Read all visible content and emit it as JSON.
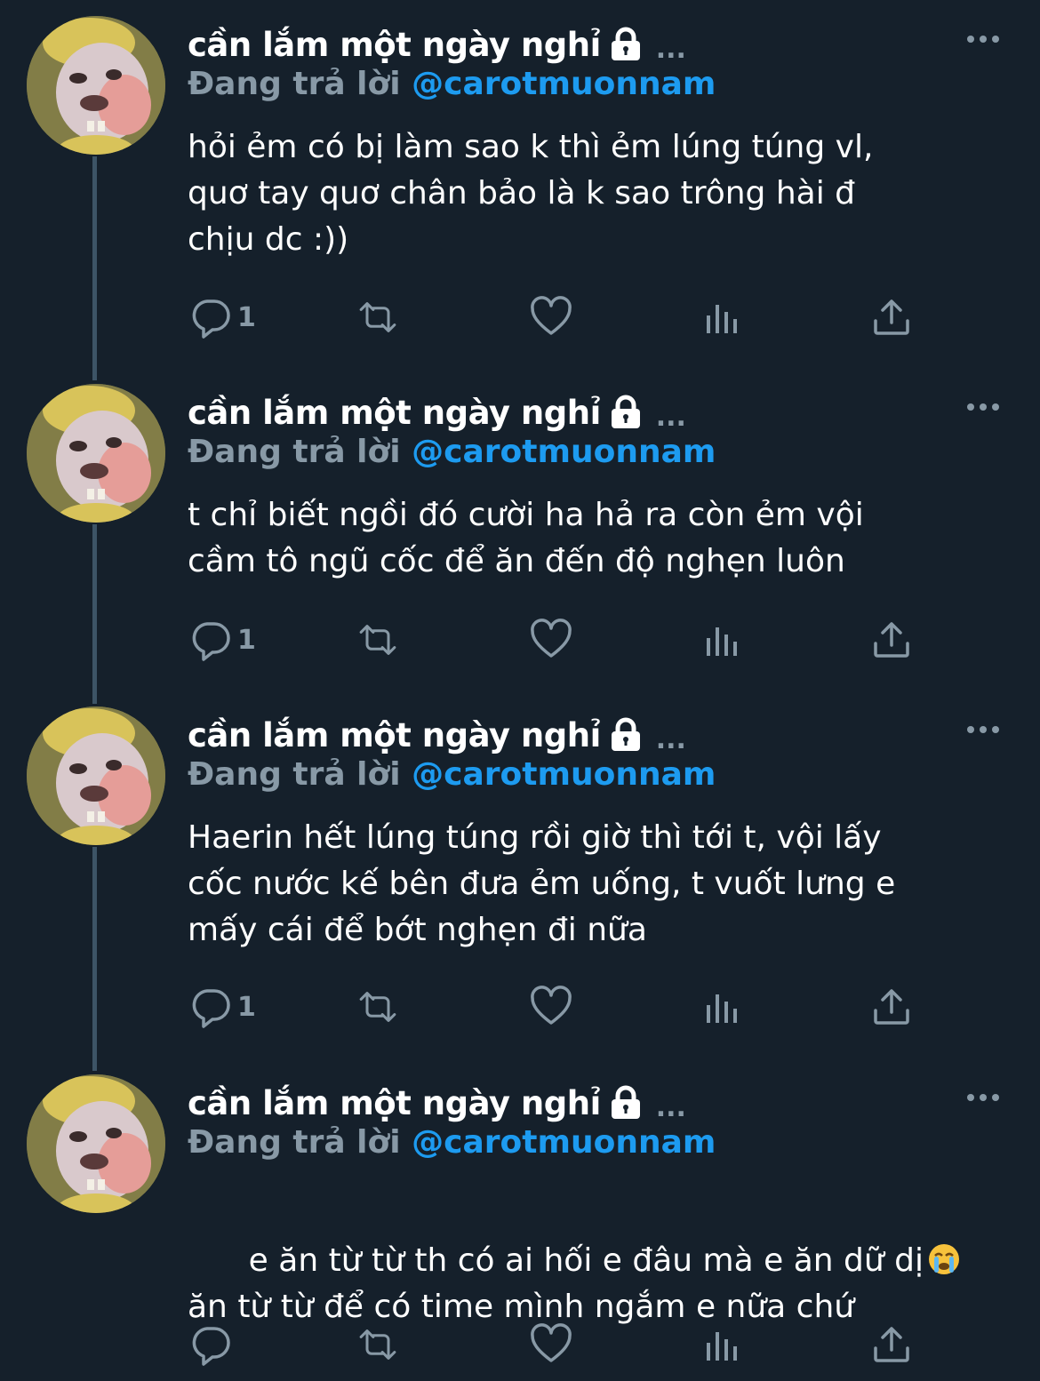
{
  "tweets": [
    {
      "display_name": "cần lắm một ngày nghỉ",
      "ellipsis": "...",
      "reply_prefix": "Đang trả lời",
      "reply_handle": "@carotmuonnam",
      "text": "hỏi ẻm có bị làm sao k thì ẻm lúng túng vl,\nquơ tay quơ chân bảo là k sao trông hài đ\nchịu dc :))",
      "reply_count": "1"
    },
    {
      "display_name": "cần lắm một ngày nghỉ",
      "ellipsis": "...",
      "reply_prefix": "Đang trả lời",
      "reply_handle": "@carotmuonnam",
      "text": "t chỉ biết ngồi đó cười ha hả ra còn ẻm vội\ncầm tô ngũ cốc để ăn đến độ nghẹn luôn",
      "reply_count": "1"
    },
    {
      "display_name": "cần lắm một ngày nghỉ",
      "ellipsis": "...",
      "reply_prefix": "Đang trả lời",
      "reply_handle": "@carotmuonnam",
      "text": "Haerin hết lúng túng rồi giờ thì tới t, vội lấy\ncốc nước kế bên đưa ẻm uống, t vuốt lưng e\nmấy cái để bớt nghẹn đi nữa",
      "reply_count": "1"
    },
    {
      "display_name": "cần lắm một ngày nghỉ",
      "ellipsis": "...",
      "reply_prefix": "Đang trả lời",
      "reply_handle": "@carotmuonnam",
      "text_line1": "e ăn từ từ th có ai hối e đâu mà e ăn dữ dị",
      "emoji": "crying-face-emoji",
      "text_line2": "ăn từ từ để có time mình ngắm e nữa chứ",
      "reply_count": ""
    }
  ],
  "colors": {
    "background": "#15202b",
    "secondary_text": "#8899a6",
    "link": "#1d9bf0",
    "thread_line": "#3d5466"
  },
  "icons": [
    "lock-icon",
    "more-icon",
    "reply-icon",
    "retweet-icon",
    "like-icon",
    "analytics-icon",
    "share-icon"
  ]
}
